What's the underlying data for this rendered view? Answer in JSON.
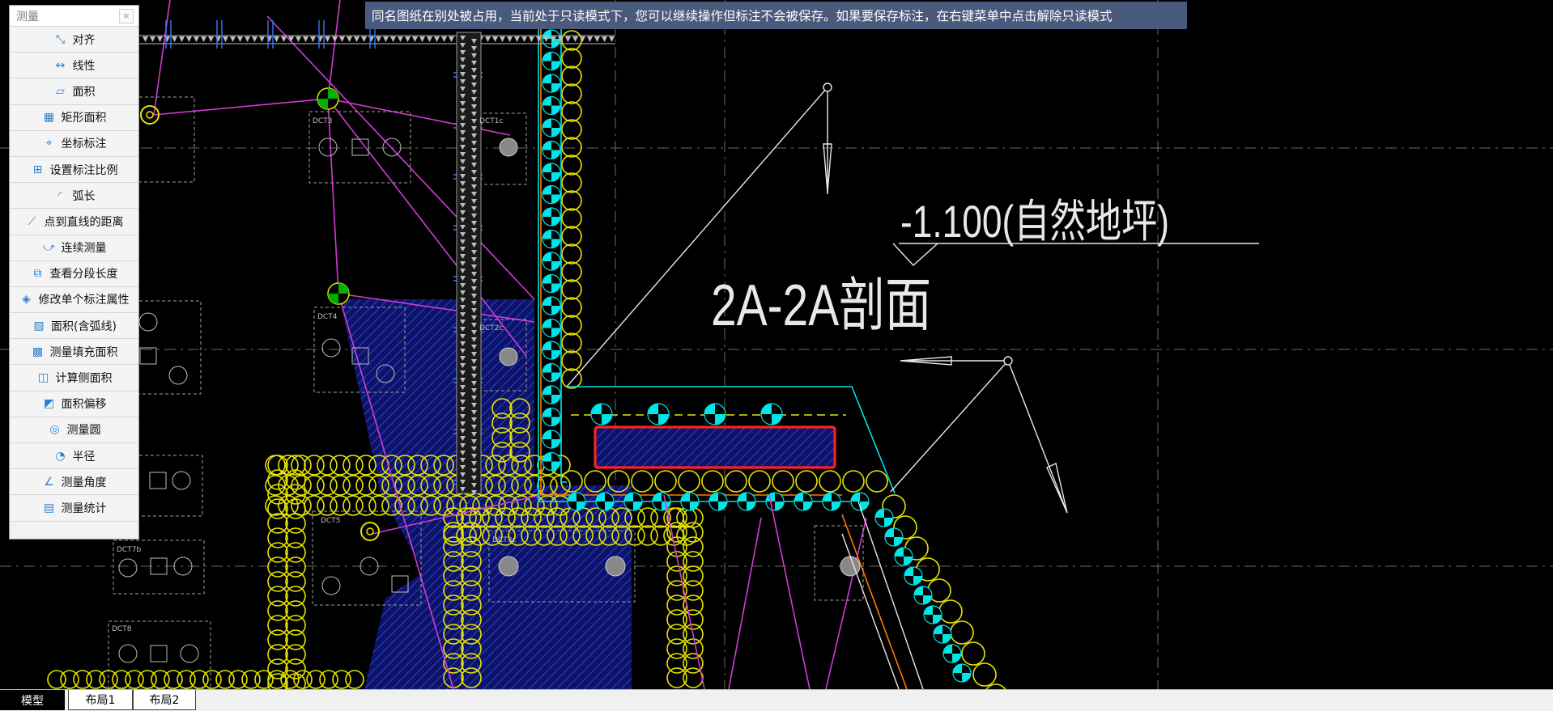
{
  "palette": {
    "title": "测量",
    "close_glyph": "×",
    "items": [
      {
        "label": "对齐",
        "icon": "align-dimension-icon"
      },
      {
        "label": "线性",
        "icon": "linear-dimension-icon"
      },
      {
        "label": "面积",
        "icon": "area-icon"
      },
      {
        "label": "矩形面积",
        "icon": "rect-area-icon"
      },
      {
        "label": "坐标标注",
        "icon": "coordinate-icon"
      },
      {
        "label": "设置标注比例",
        "icon": "scale-icon"
      },
      {
        "label": "弧长",
        "icon": "arc-length-icon"
      },
      {
        "label": "点到直线的距离",
        "icon": "point-line-distance-icon"
      },
      {
        "label": "连续测量",
        "icon": "continuous-measure-icon"
      },
      {
        "label": "查看分段长度",
        "icon": "segment-length-icon"
      },
      {
        "label": "修改单个标注属性",
        "icon": "edit-dimension-icon"
      },
      {
        "label": "面积(含弧线)",
        "icon": "arc-area-icon"
      },
      {
        "label": "测量填充面积",
        "icon": "hatch-area-icon"
      },
      {
        "label": "计算侧面积",
        "icon": "side-area-icon"
      },
      {
        "label": "面积偏移",
        "icon": "area-offset-icon"
      },
      {
        "label": "测量圆",
        "icon": "circle-measure-icon"
      },
      {
        "label": "半径",
        "icon": "radius-icon"
      },
      {
        "label": "测量角度",
        "icon": "angle-icon"
      },
      {
        "label": "测量统计",
        "icon": "statistics-icon"
      }
    ]
  },
  "notice": {
    "text": "同名图纸在别处被占用，当前处于只读模式下，您可以继续操作但标注不会被保存。如果要保存标注，在右键菜单中点击解除只读模式"
  },
  "drawing": {
    "elevation_text": "-1.100(自然地坪)",
    "section_text": "2A-2A剖面",
    "pile_labels": [
      "DCT3",
      "DCT4",
      "DCT5",
      "DCT6",
      "DCT7b",
      "DCT8",
      "DCT1c",
      "DCT2c",
      "DCT3c"
    ]
  },
  "tabs": {
    "model": "模型",
    "layout1": "布局1",
    "layout2": "布局2"
  },
  "colors": {
    "notice_bg": "#4a5a7d",
    "magenta": "#e040e0",
    "yellow": "#e6e600",
    "cyan": "#00e5e5",
    "hatch_blue": "#1a2a9a",
    "highlight_red": "#ff2020"
  }
}
